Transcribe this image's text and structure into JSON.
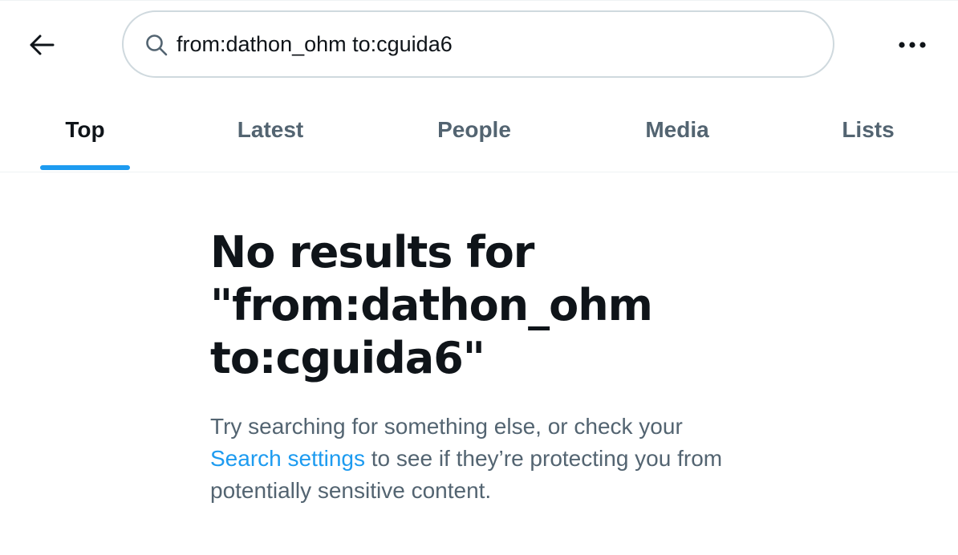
{
  "header": {
    "back_icon": "arrow-left-icon",
    "search": {
      "icon": "search-icon",
      "value": "from:dathon_ohm to:cguida6"
    },
    "more_icon": "more-horizontal-icon"
  },
  "tabs": [
    {
      "label": "Top",
      "active": true
    },
    {
      "label": "Latest",
      "active": false
    },
    {
      "label": "People",
      "active": false
    },
    {
      "label": "Media",
      "active": false
    },
    {
      "label": "Lists",
      "active": false
    }
  ],
  "empty_state": {
    "title_line1": "No results for",
    "title_line2": "\"from:dathon_ohm",
    "title_line3": "to:cguida6\"",
    "body_before_link": "Try searching for something else, or check your ",
    "link_text": "Search settings",
    "body_after_link": " to see if they’re protecting you from potentially sensitive content."
  },
  "colors": {
    "accent": "#1d9bf0",
    "text_primary": "#0f1419",
    "text_secondary": "#536471",
    "border": "#cfd9de"
  }
}
